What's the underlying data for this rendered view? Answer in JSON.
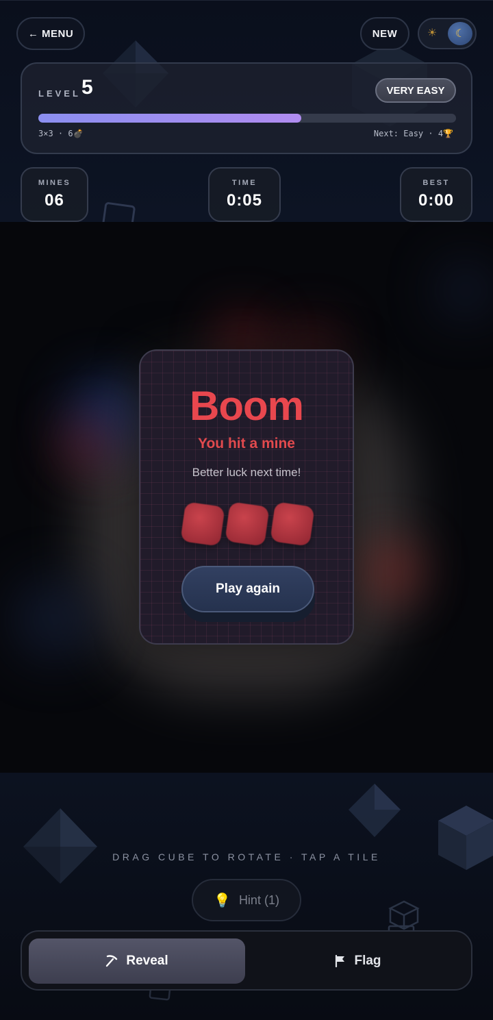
{
  "header": {
    "menu_label": "← MENU",
    "new_label": "NEW",
    "theme": {
      "light_icon": "sun-icon",
      "dark_icon": "moon-icon",
      "active": "dark"
    }
  },
  "level": {
    "label": "LEVEL",
    "number": "5",
    "difficulty": "VERY EASY",
    "progress_fraction": 0.63,
    "grid_info": "3×3 · 6💣",
    "next_info": "Next: Easy · 4🏆"
  },
  "stats": {
    "mines": {
      "label": "MINES",
      "value": "06"
    },
    "time": {
      "label": "TIME",
      "value": "0:05"
    },
    "best": {
      "label": "BEST",
      "value": "0:00"
    }
  },
  "modal": {
    "title": "Boom",
    "subtitle": "You hit a mine",
    "message": "Better luck next time!",
    "tiles": 3,
    "play_again_label": "Play again"
  },
  "footer": {
    "instructions": "DRAG CUBE TO ROTATE · TAP A TILE",
    "hint_label": "Hint (1)",
    "hint_icon": "lightbulb-icon",
    "reveal_label": "Reveal",
    "reveal_icon": "pickaxe-icon",
    "flag_label": "Flag",
    "flag_icon": "flag-icon",
    "active_mode": "reveal"
  },
  "colors": {
    "accent_red": "#e8474e",
    "progress_start": "#8b8ff0",
    "progress_end": "#b08cf0",
    "background": "#090c14"
  }
}
